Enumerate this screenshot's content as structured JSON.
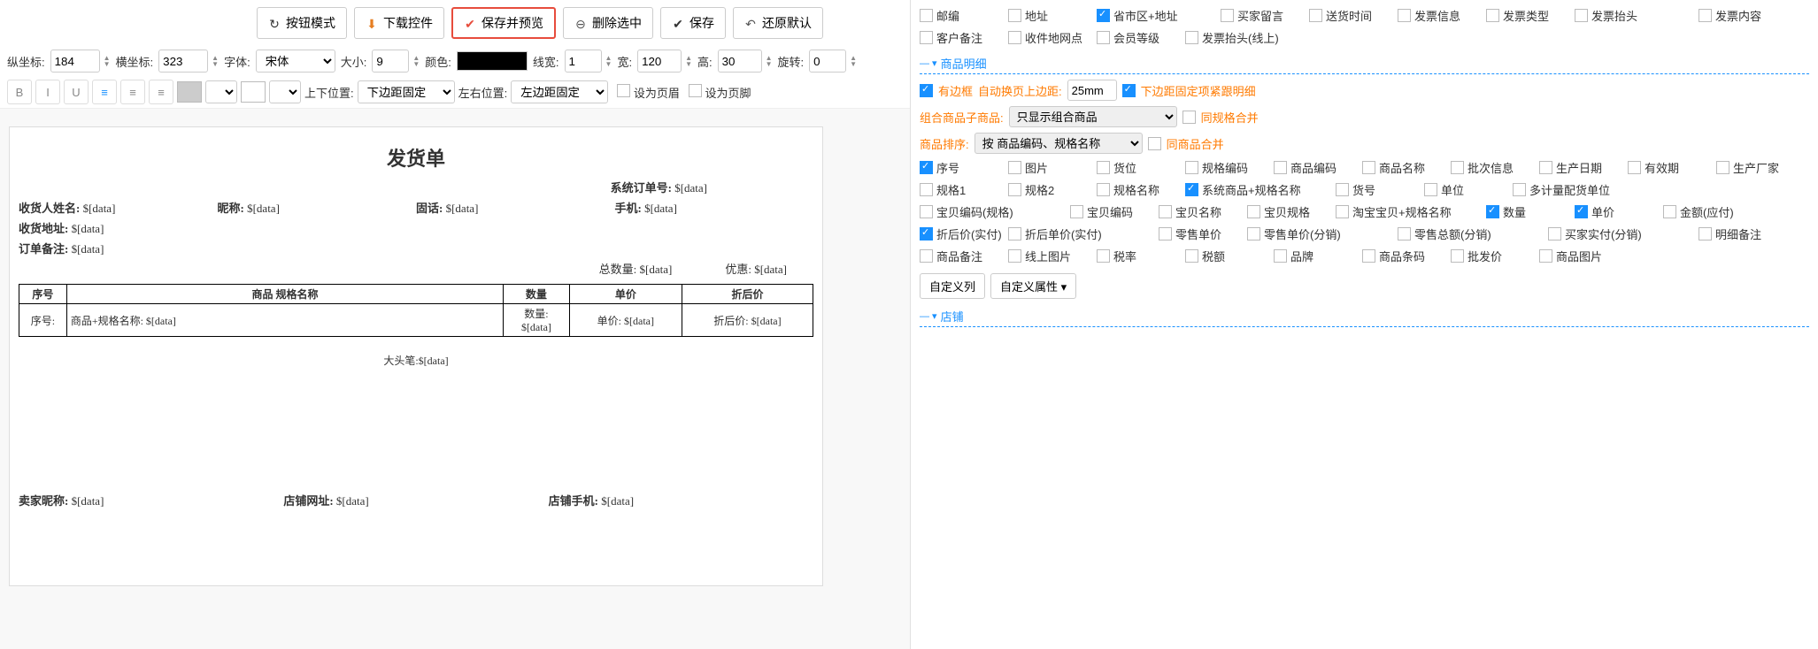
{
  "toolbar": {
    "btn_mode": "按钮模式",
    "btn_download": "下载控件",
    "btn_save_preview": "保存并预览",
    "btn_delete_sel": "删除选中",
    "btn_save": "保存",
    "btn_revert": "还原默认"
  },
  "props": {
    "y_label": "纵坐标:",
    "y_val": "184",
    "x_label": "横坐标:",
    "x_val": "323",
    "font_label": "字体:",
    "font_val": "宋体",
    "size_label": "大小:",
    "size_val": "9",
    "color_label": "颜色:",
    "color_val": "#000000",
    "linew_label": "线宽:",
    "linew_val": "1",
    "width_label": "宽:",
    "width_val": "120",
    "height_label": "高:",
    "height_val": "30",
    "rotate_label": "旋转:",
    "rotate_val": "0"
  },
  "row3": {
    "vpos_label": "上下位置:",
    "vpos_val": "下边距固定",
    "hpos_label": "左右位置:",
    "hpos_val": "左边距固定",
    "set_header": "设为页眉",
    "set_footer": "设为页脚"
  },
  "doc": {
    "title": "发货单",
    "sys_order": "系统订单号:",
    "recv_name": "收货人姓名:",
    "nick": "昵称:",
    "tel": "固话:",
    "mobile": "手机:",
    "recv_addr": "收货地址:",
    "order_remark": "订单备注:",
    "total_qty": "总数量:",
    "discount": "优惠:",
    "col_seq": "序号",
    "col_prod": "商品 规格名称",
    "col_qty": "数量",
    "col_price": "单价",
    "col_disc_price": "折后价",
    "row_seq": "序号:",
    "row_prod": "商品+规格名称:",
    "row_qty": "数量:",
    "row_price": "单价:",
    "row_disc": "折后价:",
    "cap": "大头笔:",
    "seller_nick": "卖家昵称:",
    "shop_url": "店铺网址:",
    "shop_mobile": "店铺手机:",
    "ph": "$[data]"
  },
  "rp_top": {
    "items": [
      {
        "label": "邮编",
        "checked": false,
        "w": "chk-item"
      },
      {
        "label": "地址",
        "checked": false,
        "w": "chk-item"
      },
      {
        "label": "省市区+地址",
        "checked": true,
        "w": "chk-item wide"
      },
      {
        "label": "买家留言",
        "checked": false,
        "w": "chk-item"
      },
      {
        "label": "送货时间",
        "checked": false,
        "w": "chk-item"
      },
      {
        "label": "发票信息",
        "checked": false,
        "w": "chk-item"
      },
      {
        "label": "发票类型",
        "checked": false,
        "w": "chk-item"
      },
      {
        "label": "发票抬头",
        "checked": false,
        "w": "chk-item wide"
      },
      {
        "label": "发票内容",
        "checked": false,
        "w": "chk-item"
      },
      {
        "label": "客户备注",
        "checked": false,
        "w": "chk-item"
      },
      {
        "label": "收件地网点",
        "checked": false,
        "w": "chk-item"
      },
      {
        "label": "会员等级",
        "checked": false,
        "w": "chk-item"
      },
      {
        "label": "发票抬头(线上)",
        "checked": false,
        "w": "chk-item wide"
      }
    ]
  },
  "rp_detail": {
    "header": "商品明细",
    "border_label": "有边框",
    "auto_margin_label": "自动换页上边距:",
    "auto_margin_val": "25mm",
    "bottom_fixed_label": "下边距固定项紧跟明细",
    "combo_label": "组合商品子商品:",
    "combo_val": "只显示组合商品",
    "same_spec_merge": "同规格合并",
    "sort_label": "商品排序:",
    "sort_val": "按 商品编码、规格名称",
    "same_prod_merge": "同商品合并",
    "items": [
      {
        "label": "序号",
        "checked": true,
        "w": "chk-item"
      },
      {
        "label": "图片",
        "checked": false,
        "w": "chk-item"
      },
      {
        "label": "货位",
        "checked": false,
        "w": "chk-item"
      },
      {
        "label": "规格编码",
        "checked": false,
        "w": "chk-item"
      },
      {
        "label": "商品编码",
        "checked": false,
        "w": "chk-item"
      },
      {
        "label": "商品名称",
        "checked": false,
        "w": "chk-item"
      },
      {
        "label": "批次信息",
        "checked": false,
        "w": "chk-item"
      },
      {
        "label": "生产日期",
        "checked": false,
        "w": "chk-item"
      },
      {
        "label": "有效期",
        "checked": false,
        "w": "chk-item"
      },
      {
        "label": "生产厂家",
        "checked": false,
        "w": "chk-item"
      },
      {
        "label": "规格1",
        "checked": false,
        "w": "chk-item"
      },
      {
        "label": "规格2",
        "checked": false,
        "w": "chk-item"
      },
      {
        "label": "规格名称",
        "checked": false,
        "w": "chk-item"
      },
      {
        "label": "系统商品+规格名称",
        "checked": true,
        "w": "chk-item wider"
      },
      {
        "label": "货号",
        "checked": false,
        "w": "chk-item"
      },
      {
        "label": "单位",
        "checked": false,
        "w": "chk-item"
      },
      {
        "label": "多计量配货单位",
        "checked": false,
        "w": "chk-item wider"
      },
      {
        "label": "宝贝编码(规格)",
        "checked": false,
        "w": "chk-item wider"
      },
      {
        "label": "宝贝编码",
        "checked": false,
        "w": "chk-item"
      },
      {
        "label": "宝贝名称",
        "checked": false,
        "w": "chk-item"
      },
      {
        "label": "宝贝规格",
        "checked": false,
        "w": "chk-item"
      },
      {
        "label": "淘宝宝贝+规格名称",
        "checked": false,
        "w": "chk-item wider"
      },
      {
        "label": "数量",
        "checked": true,
        "w": "chk-item"
      },
      {
        "label": "单价",
        "checked": true,
        "w": "chk-item"
      },
      {
        "label": "金额(应付)",
        "checked": false,
        "w": "chk-item"
      },
      {
        "label": "折后价(实付)",
        "checked": true,
        "w": "chk-item"
      },
      {
        "label": "折后单价(实付)",
        "checked": false,
        "w": "chk-item wider"
      },
      {
        "label": "零售单价",
        "checked": false,
        "w": "chk-item"
      },
      {
        "label": "零售单价(分销)",
        "checked": false,
        "w": "chk-item wider"
      },
      {
        "label": "零售总额(分销)",
        "checked": false,
        "w": "chk-item wider"
      },
      {
        "label": "买家实付(分销)",
        "checked": false,
        "w": "chk-item wider"
      },
      {
        "label": "明细备注",
        "checked": false,
        "w": "chk-item"
      },
      {
        "label": "商品备注",
        "checked": false,
        "w": "chk-item"
      },
      {
        "label": "线上图片",
        "checked": false,
        "w": "chk-item"
      },
      {
        "label": "税率",
        "checked": false,
        "w": "chk-item"
      },
      {
        "label": "税额",
        "checked": false,
        "w": "chk-item"
      },
      {
        "label": "品牌",
        "checked": false,
        "w": "chk-item"
      },
      {
        "label": "商品条码",
        "checked": false,
        "w": "chk-item"
      },
      {
        "label": "批发价",
        "checked": false,
        "w": "chk-item"
      },
      {
        "label": "商品图片",
        "checked": false,
        "w": "chk-item"
      }
    ],
    "custom_col": "自定义列",
    "custom_attr": "自定义属性"
  },
  "rp_shop": {
    "header": "店铺"
  }
}
